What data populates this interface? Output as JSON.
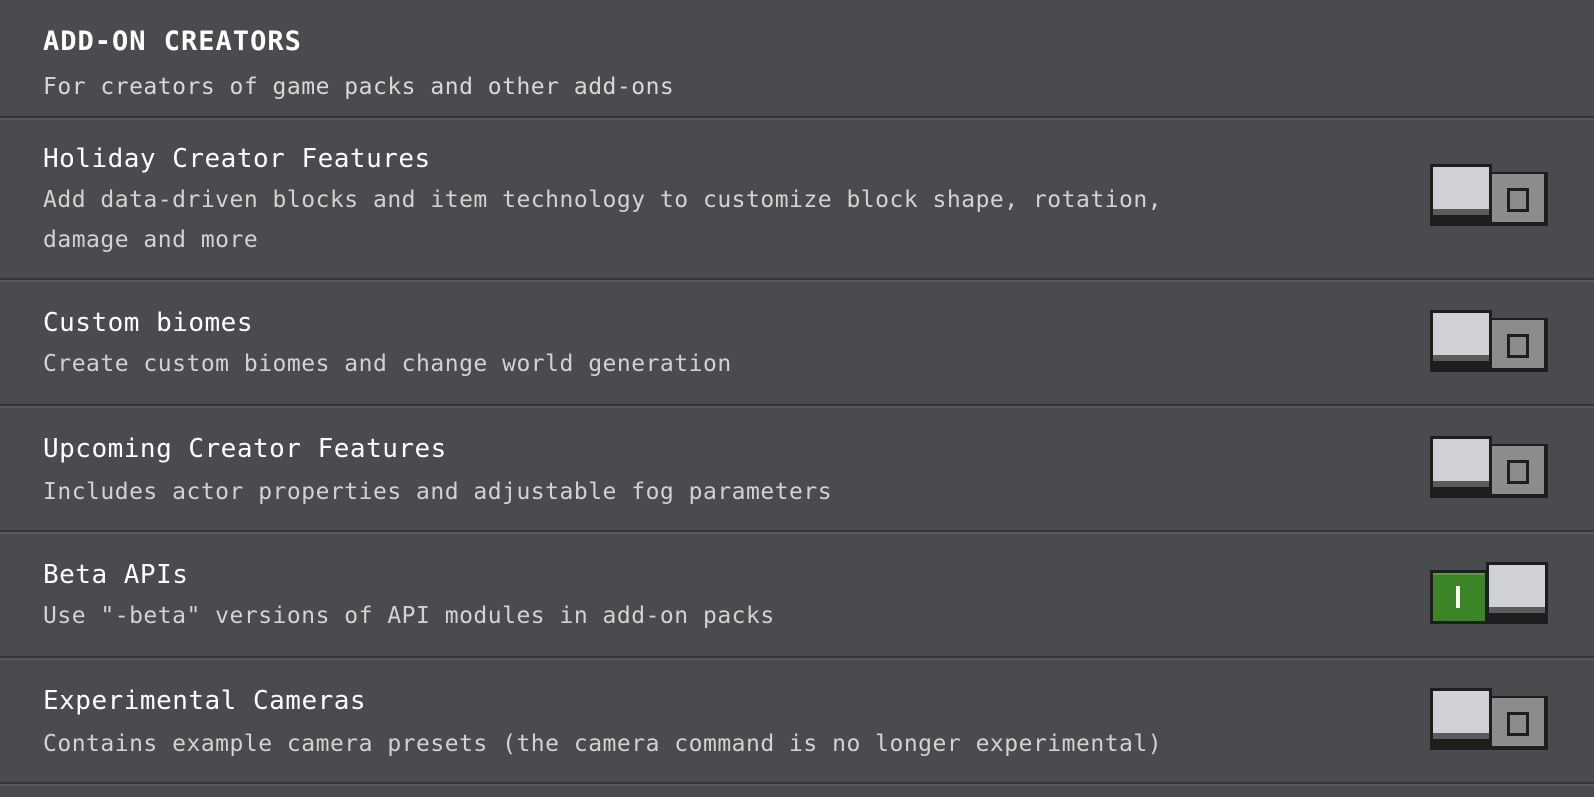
{
  "section": {
    "title": "ADD-ON CREATORS",
    "subtitle": "For creators of game packs and other add-ons"
  },
  "settings": [
    {
      "title": "Holiday Creator Features",
      "description": "Add data-driven blocks and item technology to customize block shape, rotation, damage and more",
      "enabled": false,
      "toggle_icon": "O"
    },
    {
      "title": "Custom biomes",
      "description": "Create custom biomes and change world generation",
      "enabled": false,
      "toggle_icon": "O"
    },
    {
      "title": "Upcoming Creator Features",
      "description": "Includes actor properties and adjustable fog parameters",
      "enabled": false,
      "toggle_icon": "O"
    },
    {
      "title": "Beta APIs",
      "description": "Use \"-beta\" versions of API modules in add-on packs",
      "enabled": true,
      "toggle_icon": "I"
    },
    {
      "title": "Experimental Cameras",
      "description": "Contains example camera presets (the camera command is no longer experimental)",
      "enabled": false,
      "toggle_icon": "O"
    }
  ],
  "colors": {
    "background": "#4a4b4e",
    "toggle_on": "#3c8527",
    "toggle_off_track": "#8c8c8c",
    "knob": "#d0d1d4"
  }
}
